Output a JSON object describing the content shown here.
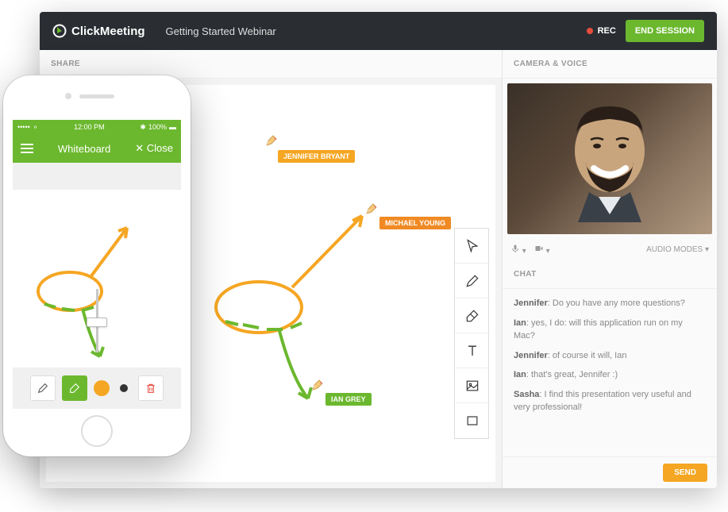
{
  "app": {
    "brand": "ClickMeeting",
    "session_title": "Getting Started Webinar",
    "rec_label": "REC",
    "end_session": "END SESSION"
  },
  "panels": {
    "share": "SHARE",
    "camera": "CAMERA & VOICE",
    "chat": "CHAT",
    "audio_modes": "AUDIO MODES"
  },
  "whiteboard_users": {
    "u1": "JENNIFER BRYANT",
    "u2": "MICHAEL YOUNG",
    "u3": "IAN GREY"
  },
  "tools": [
    "cursor",
    "pencil",
    "eraser",
    "text",
    "image",
    "rectangle"
  ],
  "chat": {
    "messages": [
      {
        "author": "Jennifer",
        "text": "Do you have any more questions?"
      },
      {
        "author": "Ian",
        "text": "yes, I do: will this application run on my Mac?"
      },
      {
        "author": "Jennifer",
        "text": "of course it will, Ian"
      },
      {
        "author": "Ian",
        "text": "that's great, Jennifer :)"
      },
      {
        "author": "Sasha",
        "text": "I find this presentation very useful and very professional!"
      }
    ],
    "send": "SEND"
  },
  "phone": {
    "time": "12:00 PM",
    "battery": "100%",
    "title": "Whiteboard",
    "close": "✕ Close",
    "colors": {
      "orange": "#f5a623",
      "black": "#333"
    }
  }
}
